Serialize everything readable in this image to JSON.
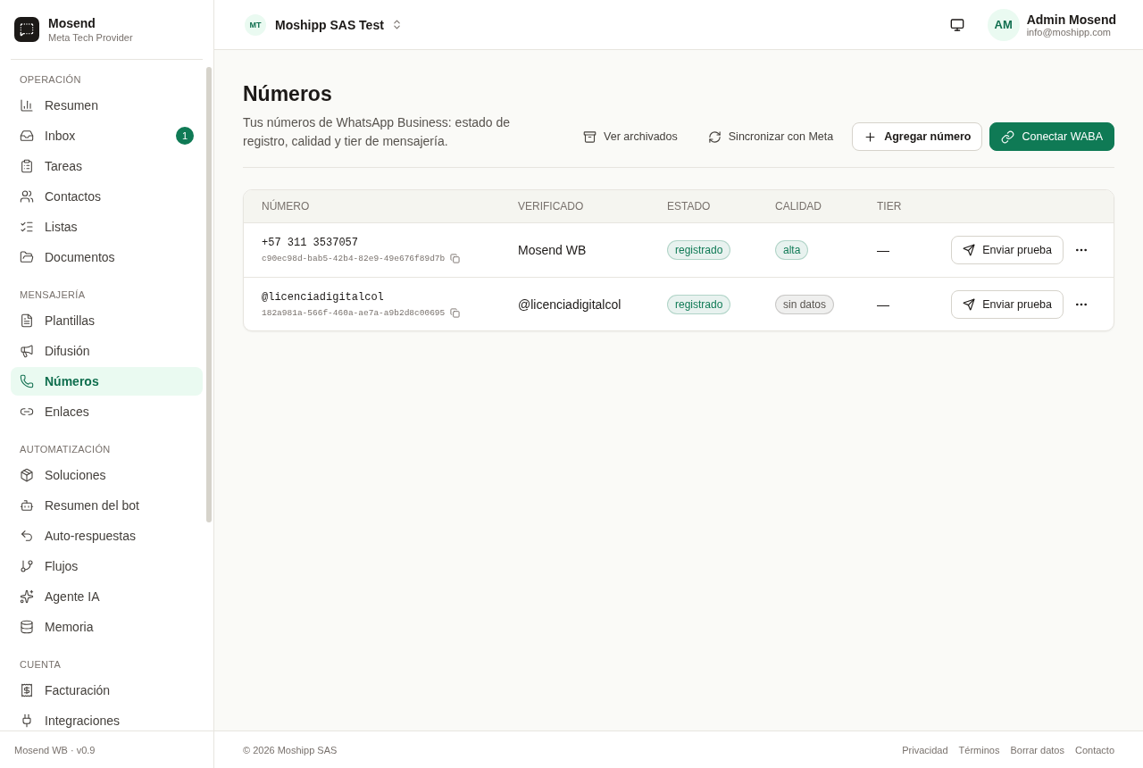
{
  "brand": {
    "name": "Mosend",
    "subtitle": "Meta Tech Provider"
  },
  "sidebar": {
    "sections": [
      {
        "title": "OPERACIÓN",
        "items": [
          {
            "label": "Resumen",
            "selected": false
          },
          {
            "label": "Inbox",
            "selected": false,
            "badge": "1"
          },
          {
            "label": "Tareas",
            "selected": false
          },
          {
            "label": "Contactos",
            "selected": false
          },
          {
            "label": "Listas",
            "selected": false
          },
          {
            "label": "Documentos",
            "selected": false
          }
        ]
      },
      {
        "title": "MENSAJERÍA",
        "items": [
          {
            "label": "Plantillas",
            "selected": false
          },
          {
            "label": "Difusión",
            "selected": false
          },
          {
            "label": "Números",
            "selected": true
          },
          {
            "label": "Enlaces",
            "selected": false
          }
        ]
      },
      {
        "title": "AUTOMATIZACIÓN",
        "items": [
          {
            "label": "Soluciones",
            "selected": false
          },
          {
            "label": "Resumen del bot",
            "selected": false
          },
          {
            "label": "Auto-respuestas",
            "selected": false
          },
          {
            "label": "Flujos",
            "selected": false
          },
          {
            "label": "Agente IA",
            "selected": false
          },
          {
            "label": "Memoria",
            "selected": false
          }
        ]
      },
      {
        "title": "CUENTA",
        "items": [
          {
            "label": "Facturación",
            "selected": false
          },
          {
            "label": "Integraciones",
            "selected": false
          }
        ]
      }
    ],
    "version": "Mosend WB · v0.9"
  },
  "topbar": {
    "org_initials": "MT",
    "org_name": "Moshipp SAS Test",
    "user_initials": "AM",
    "user_name": "Admin Mosend",
    "user_email": "info@moshipp.com"
  },
  "page": {
    "title": "Números",
    "description": "Tus números de WhatsApp Business: estado de registro, calidad y tier de mensajería.",
    "actions": [
      {
        "label": "Ver archivados",
        "kind": "ghost"
      },
      {
        "label": "Sincronizar con Meta",
        "kind": "ghost"
      },
      {
        "label": "Agregar número",
        "kind": "outline"
      },
      {
        "label": "Conectar WABA",
        "kind": "primary"
      }
    ]
  },
  "table": {
    "columns": [
      "NÚMERO",
      "VERIFICADO",
      "ESTADO",
      "CALIDAD",
      "TIER"
    ],
    "rows": [
      {
        "number": "+57 311 3537057",
        "id": "c90ec98d-bab5-42b4-82e9-49e676f89d7b",
        "verified": "Mosend WB",
        "status": {
          "label": "registrado",
          "color": "#0f7a55"
        },
        "quality": {
          "label": "alta",
          "color": "#0f7a55"
        },
        "tier": "—",
        "action": "Enviar prueba"
      },
      {
        "number": "@licenciadigitalcol",
        "id": "182a981a-566f-460a-ae7a-a9b2d8c00695",
        "verified": "@licenciadigitalcol",
        "status": {
          "label": "registrado",
          "color": "#0f7a55"
        },
        "quality": {
          "label": "sin datos",
          "color": "#57534e"
        },
        "tier": "—",
        "action": "Enviar prueba"
      }
    ]
  },
  "footer": {
    "copyright": "© 2026 Moshipp SAS",
    "links": [
      "Privacidad",
      "Términos",
      "Borrar datos",
      "Contacto"
    ]
  }
}
